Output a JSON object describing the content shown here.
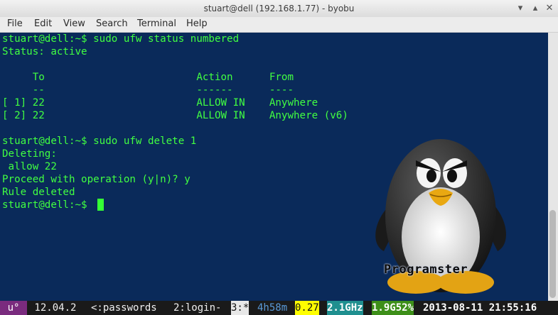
{
  "window": {
    "title": "stuart@dell (192.168.1.77) - byobu",
    "minimize_glyph": "▾",
    "maximize_glyph": "▴",
    "close_glyph": "✕"
  },
  "menu": [
    "File",
    "Edit",
    "View",
    "Search",
    "Terminal",
    "Help"
  ],
  "terminal": {
    "lines": [
      "stuart@dell:~$ sudo ufw status numbered",
      "Status: active",
      "",
      "     To                         Action      From",
      "     --                         ------      ----",
      "[ 1] 22                         ALLOW IN    Anywhere",
      "[ 2] 22                         ALLOW IN    Anywhere (v6)",
      "",
      "stuart@dell:~$ sudo ufw delete 1",
      "Deleting:",
      " allow 22",
      "Proceed with operation (y|n)? y",
      "Rule deleted",
      "stuart@dell:~$ "
    ]
  },
  "wallpaper": {
    "logo_text": "Programster"
  },
  "statusbar": {
    "distro": "u°",
    "release": " 12.04.2 ",
    "window1": "<:passwords ",
    "window2": "2:login- ",
    "window3": "3:*",
    "uptime": "4h58m",
    "load": "0.27",
    "cpu_freq": "2.1GHz",
    "mem": "1.9G52%",
    "datetime": "2013-08-11 21:55:16"
  },
  "colors": {
    "terminal_bg": "#0a2a5a",
    "terminal_fg": "#41ff41",
    "status_distro_bg": "#7a2b7e",
    "status_load_bg": "#ffff00",
    "status_cpu_bg": "#1f8f8f",
    "status_mem_bg": "#3d8f19"
  }
}
